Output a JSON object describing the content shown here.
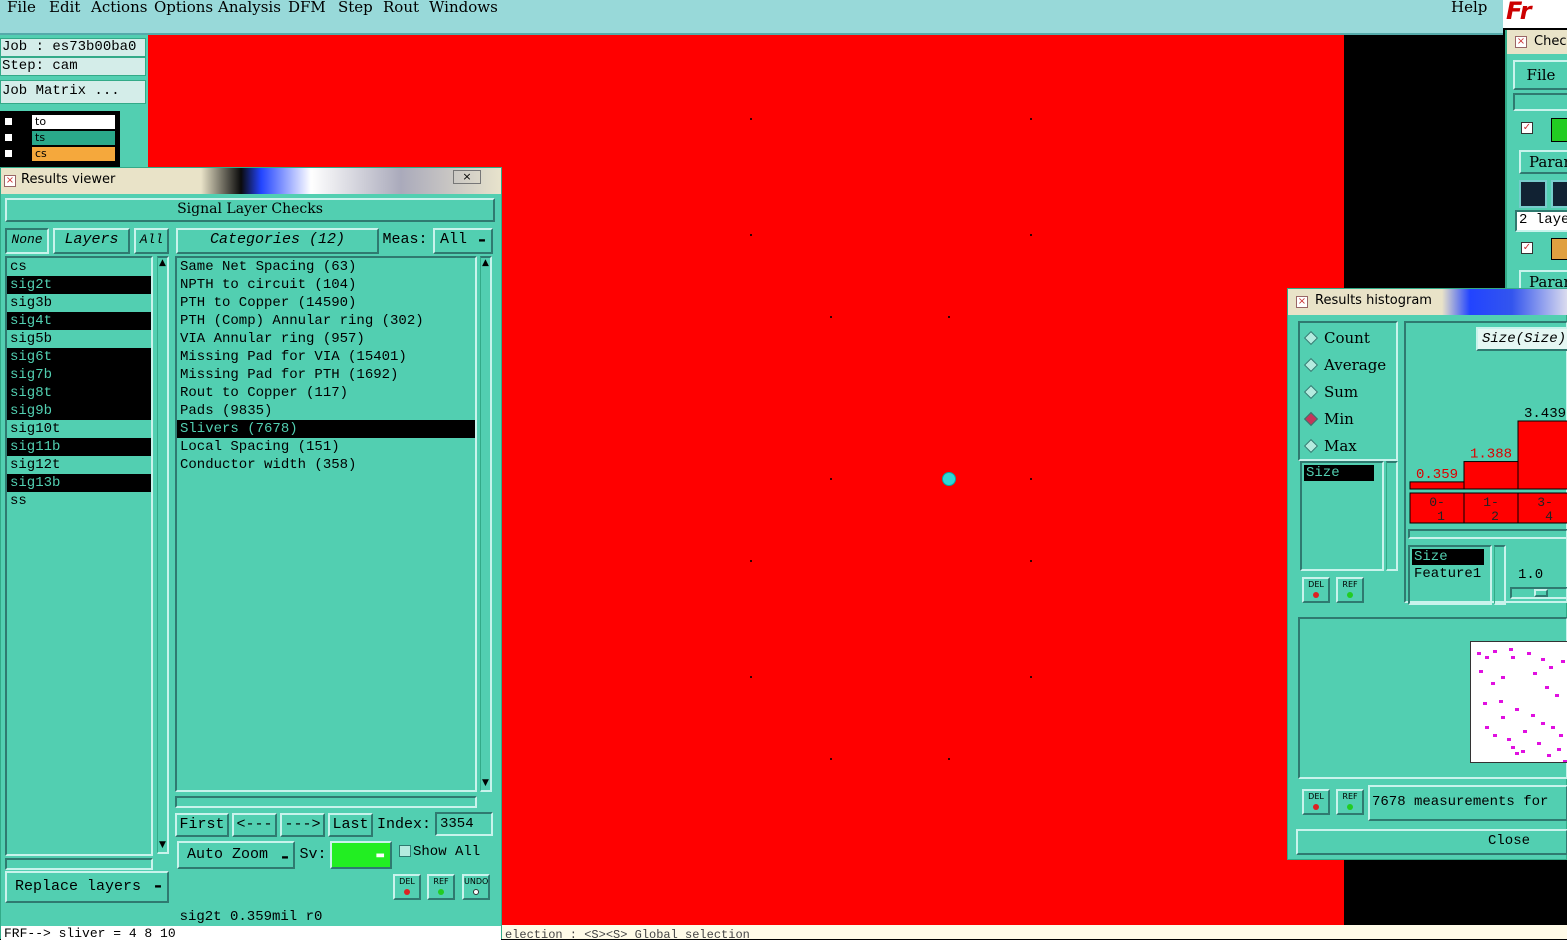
{
  "menubar": {
    "items": [
      "File",
      "Edit",
      "Actions",
      "Options",
      "Analysis",
      "DFM",
      "Step",
      "Rout",
      "Windows"
    ],
    "help": "Help",
    "logo": "Fr"
  },
  "job_panel": {
    "job": "Job : es73b00ba0",
    "step": "Step: cam",
    "job_matrix": "Job Matrix ...",
    "layers": [
      {
        "name": "to",
        "color": "#ffffff"
      },
      {
        "name": "ts",
        "color": "#2aa88a"
      },
      {
        "name": "cs",
        "color": "#f5a83c"
      }
    ]
  },
  "results_viewer": {
    "title": "Results viewer",
    "section_title": "Signal Layer Checks",
    "btn_none": "None",
    "btn_layers": "Layers",
    "btn_all": "All",
    "categories_label": "Categories (12)",
    "meas_label": "Meas:",
    "meas_value": "All",
    "layers": [
      {
        "name": "cs",
        "selected": false
      },
      {
        "name": "sig2t",
        "selected": true
      },
      {
        "name": "sig3b",
        "selected": false
      },
      {
        "name": "sig4t",
        "selected": true
      },
      {
        "name": "sig5b",
        "selected": false
      },
      {
        "name": "sig6t",
        "selected": true
      },
      {
        "name": "sig7b",
        "selected": true
      },
      {
        "name": "sig8t",
        "selected": true
      },
      {
        "name": "sig9b",
        "selected": true
      },
      {
        "name": "sig10t",
        "selected": false
      },
      {
        "name": "sig11b",
        "selected": true
      },
      {
        "name": "sig12t",
        "selected": false
      },
      {
        "name": "sig13b",
        "selected": true
      },
      {
        "name": "ss",
        "selected": false
      }
    ],
    "categories": [
      {
        "name": "Same Net Spacing (63)",
        "selected": false
      },
      {
        "name": "NPTH to circuit (104)",
        "selected": false
      },
      {
        "name": "PTH to Copper (14590)",
        "selected": false
      },
      {
        "name": "PTH (Comp) Annular ring (302)",
        "selected": false
      },
      {
        "name": "VIA Annular ring (957)",
        "selected": false
      },
      {
        "name": "Missing Pad for VIA (15401)",
        "selected": false
      },
      {
        "name": "Missing Pad for PTH (1692)",
        "selected": false
      },
      {
        "name": "Rout to Copper (117)",
        "selected": false
      },
      {
        "name": "Pads (9835)",
        "selected": false
      },
      {
        "name": "Slivers (7678)",
        "selected": true
      },
      {
        "name": "Local Spacing (151)",
        "selected": false
      },
      {
        "name": "Conductor width (358)",
        "selected": false
      }
    ],
    "nav": {
      "first": "First",
      "prev": "<---",
      "next": "--->",
      "last": "Last",
      "index_label": "Index:",
      "index_value": "3354"
    },
    "auto_zoom": "Auto Zoom",
    "sv_label": "Sv:",
    "show_all": "Show All",
    "replace_layers": "Replace layers",
    "icons": {
      "del": "DEL",
      "ref": "REF",
      "undo": "UNDO"
    },
    "status": "sig2t 0.359mil  r0",
    "command": "FRF--> sliver = 4 8 10"
  },
  "bottom_message": "election : <S><S> Global selection",
  "histogram": {
    "title": "Results histogram",
    "modes": [
      {
        "label": "Count",
        "on": false
      },
      {
        "label": "Average",
        "on": false
      },
      {
        "label": "Sum",
        "on": false
      },
      {
        "label": "Min",
        "on": true
      },
      {
        "label": "Max",
        "on": false
      }
    ],
    "measure_list": [
      "Size"
    ],
    "chart_label": "Size(Size)",
    "bins": [
      {
        "range": "0-\n1",
        "value": 0.359
      },
      {
        "range": "1-\n2",
        "value": 1.388
      },
      {
        "range": "3-\n4",
        "value": 3.439
      }
    ],
    "attr_list": [
      "Size",
      "Feature1"
    ],
    "scale_value": "1.0",
    "measurements_text": "7678 measurements for",
    "close": "Close",
    "icons": {
      "del": "DEL",
      "ref": "REF"
    }
  },
  "checklist": {
    "title": "Check",
    "file": "File",
    "param1": "Paran",
    "layers_text": "2 laye",
    "param2": "Paran"
  }
}
